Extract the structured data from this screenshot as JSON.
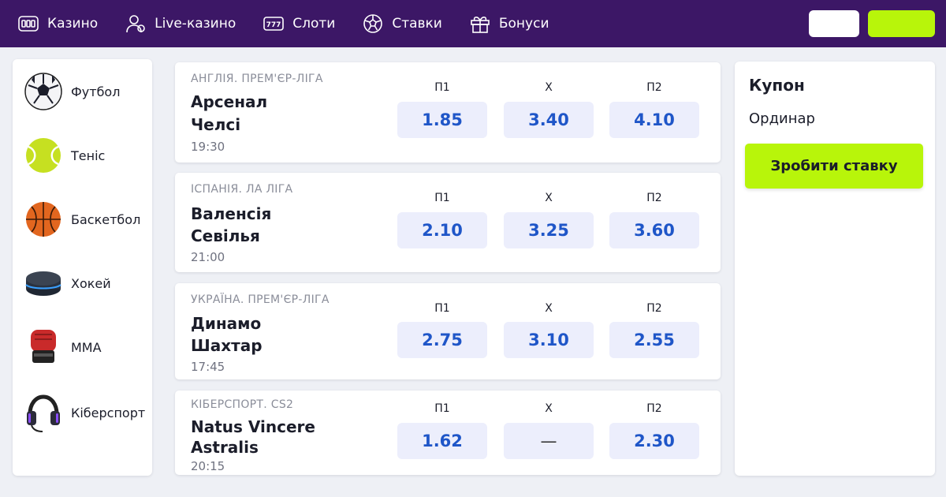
{
  "nav": {
    "items": [
      {
        "label": "Казино",
        "icon": "slot-machine-icon"
      },
      {
        "label": "Live-казино",
        "icon": "live-dealer-icon"
      },
      {
        "label": "Слоти",
        "icon": "777-slots-icon"
      },
      {
        "label": "Ставки",
        "icon": "soccer-ball-icon"
      },
      {
        "label": "Бонуси",
        "icon": "gift-icon"
      }
    ],
    "login_label": "",
    "register_label": ""
  },
  "sidebar": {
    "sports": [
      {
        "label": "Футбол",
        "icon": "football-icon"
      },
      {
        "label": "Теніс",
        "icon": "tennis-ball-icon"
      },
      {
        "label": "Баскетбол",
        "icon": "basketball-icon"
      },
      {
        "label": "Хокей",
        "icon": "hockey-puck-icon"
      },
      {
        "label": "MMA",
        "icon": "mma-glove-icon"
      },
      {
        "label": "Кіберспорт",
        "icon": "headset-icon"
      }
    ]
  },
  "odds_headers": {
    "home": "П1",
    "draw": "X",
    "away": "П2"
  },
  "matches": [
    {
      "league": "АНГЛІЯ. ПРЕМ'ЄР-ЛІГА",
      "team1": "Арсенал",
      "team2": "Челсі",
      "time": "19:30",
      "odds": {
        "p1": "1.85",
        "x": "3.40",
        "p2": "4.10"
      }
    },
    {
      "league": "ІСПАНІЯ. ЛА ЛІГА",
      "team1": "Валенсія",
      "team2": "Севілья",
      "time": "21:00",
      "odds": {
        "p1": "2.10",
        "x": "3.25",
        "p2": "3.60"
      }
    },
    {
      "league": "УКРАЇНА. ПРЕМ'ЄР-ЛІГА",
      "team1": "Динамо",
      "team2": "Шахтар",
      "time": "17:45",
      "odds": {
        "p1": "2.75",
        "x": "3.10",
        "p2": "2.55"
      }
    },
    {
      "league": "КІБЕРСПОРТ. CS2",
      "team1": "Natus Vincere",
      "team2": "Astralis",
      "time": "20:15",
      "odds": {
        "p1": "1.62",
        "x": "—",
        "p2": "2.30"
      }
    }
  ],
  "coupon": {
    "title": "Купон",
    "bet_type": "Ординар",
    "submit_label": "Зробити ставку"
  },
  "colors": {
    "header_bg": "#3c1766",
    "accent_lime": "#b8f50a",
    "odds_text": "#1f56c8",
    "odds_bg": "#eceefc",
    "page_bg": "#eef0f5"
  }
}
